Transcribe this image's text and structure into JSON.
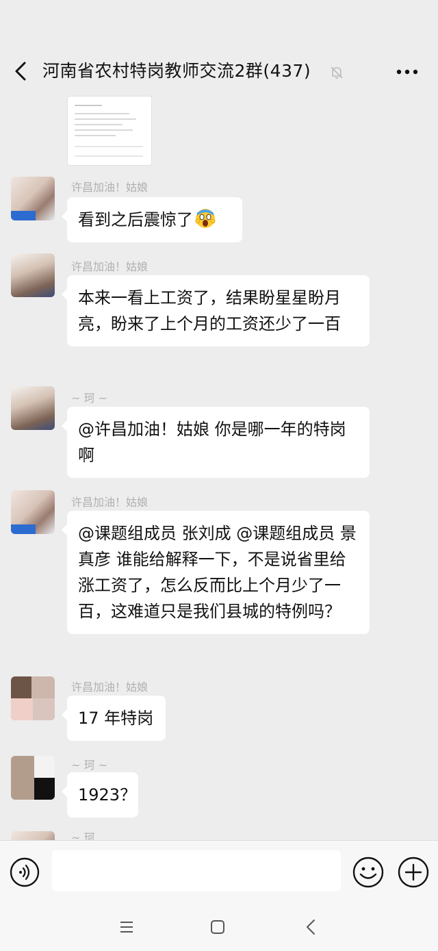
{
  "header": {
    "title": "河南省农村特岗教师交流2群(437)",
    "back_icon": "chevron-left-icon",
    "mute_icon": "bell-mute-icon",
    "more_icon": "more-dots-icon"
  },
  "messages": [
    {
      "sender": "许昌加油！姑娘",
      "text": "看到之后震惊了",
      "emoji": "screaming-face-emoji"
    },
    {
      "sender": "许昌加油！姑娘",
      "text": "本来一看上工资了，结果盼星星盼月亮，盼来了上个月的工资还少了一百"
    },
    {
      "sender": "~ 珂 ~",
      "text": "@许昌加油！姑娘  你是哪一年的特岗啊"
    },
    {
      "sender": "许昌加油！姑娘",
      "text": "@课题组成员  张刘成 @课题组成员 景真彦  谁能给解释一下，不是说省里给涨工资了，怎么反而比上个月少了一百，这难道只是我们县城的特例吗？"
    },
    {
      "sender": "许昌加油！姑娘",
      "text": "17 年特岗"
    },
    {
      "sender": "~ 珂 ~",
      "text": "1923？"
    }
  ],
  "partial_message": {
    "sender": "~ 珂"
  },
  "input_bar": {
    "placeholder": "",
    "voice_icon": "voice-icon",
    "emoji_icon": "emoji-smile-icon",
    "plus_icon": "plus-circle-icon"
  },
  "navbar": {
    "menu_icon": "menu-icon",
    "home_icon": "home-square-icon",
    "back_icon": "back-triangle-icon"
  },
  "colors": {
    "background": "#ededed",
    "bubble": "#ffffff",
    "sender_text": "#b0b0b0"
  }
}
